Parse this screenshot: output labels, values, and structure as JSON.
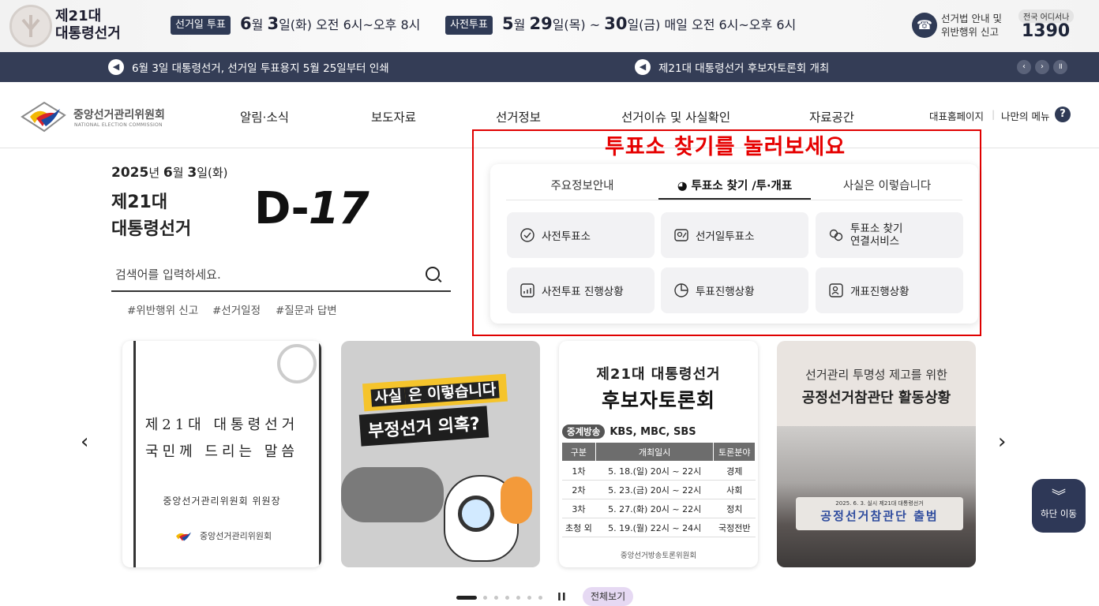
{
  "topbar": {
    "election_title_line1": "제21대",
    "election_title_line2": "대통령선거",
    "election_day_badge": "선거일 투표",
    "election_day_month": "6",
    "election_day_month_unit": "월",
    "election_day_date": "3",
    "election_day_rest": "일(화) 오전 6시~오후 8시",
    "early_vote_badge": "사전투표",
    "early_month": "5",
    "early_month_unit": "월",
    "early_date1": "29",
    "early_mid": "일(목) ~",
    "early_date2": "30",
    "early_rest": "일(금) 매일 오전 6시~오후 6시",
    "hotline_label_line1": "선거법 안내 및",
    "hotline_label_line2": "위반행위 신고",
    "hotline_small": "전국 어디서나",
    "hotline_number": "1390"
  },
  "newsbar": {
    "items": [
      "6월 3일 대통령선거, 선거일 투표용지 5월 25일부터 인쇄",
      "제21대 대통령선거 후보자토론회 개최"
    ]
  },
  "header": {
    "org_name": "중앙선거관리위원회",
    "org_name_en": "NATIONAL ELECTION COMMISSION",
    "menu": [
      "알림·소식",
      "보도자료",
      "선거정보",
      "선거이슈 및 사실확인",
      "자료공간"
    ],
    "util_home": "대표홈페이지",
    "util_mymenu": "나만의 메뉴",
    "help_glyph": "?"
  },
  "hero": {
    "date_year": "2025",
    "date_year_unit": "년",
    "date_month": "6",
    "date_month_unit": "월",
    "date_day": "3",
    "date_day_rest": "일(화)",
    "title_line1": "제21대",
    "title_line2": "대통령선거",
    "dday_prefix": "D-",
    "dday_num": "17",
    "search_placeholder": "검색어를 입력하세요.",
    "tags": [
      "#위반행위 신고",
      "#선거일정",
      "#질문과 답변"
    ]
  },
  "annotation": {
    "note": "투표소 찾기를 눌러보세요"
  },
  "panel": {
    "tabs": [
      "주요정보안내",
      "투표소 찾기 /투·개표",
      "사실은 이렇습니다"
    ],
    "buttons": [
      {
        "label": "사전투표소",
        "icon": "check-circle-icon"
      },
      {
        "label": "선거일투표소",
        "icon": "ballot-icon"
      },
      {
        "label": "투표소 찾기\n연결서비스",
        "icon": "link-icon"
      },
      {
        "label": "사전투표 진행상황",
        "icon": "chart-icon"
      },
      {
        "label": "투표진행상황",
        "icon": "pie-icon"
      },
      {
        "label": "개표진행상황",
        "icon": "person-check-icon"
      }
    ],
    "btn3_line1": "투표소 찾기",
    "btn3_line2": "연결서비스"
  },
  "carousel": {
    "prev_glyph": "‹",
    "next_glyph": "›",
    "card1": {
      "line1": "제21대 대통령선거",
      "line2": "국민께 드리는 말씀",
      "sign": "중앙선거관리위원회 위원장",
      "logo_text": "중앙선거관리위원회"
    },
    "card2": {
      "badge_highlight": "사실",
      "badge_rest": "은 이렇습니다",
      "title": "부정선거 의혹?"
    },
    "card3": {
      "title": "제21대 대통령선거",
      "subtitle": "후보자토론회",
      "broadcast_label": "중계방송",
      "broadcast": "KBS, MBC, SBS",
      "headers": [
        "구분",
        "개최일시",
        "토론분야"
      ],
      "rows": [
        [
          "1차",
          "5. 18.(일) 20시 ~ 22시",
          "경제"
        ],
        [
          "2차",
          "5. 23.(금) 20시 ~ 22시",
          "사회"
        ],
        [
          "3차",
          "5. 27.(화) 20시 ~ 22시",
          "정치"
        ],
        [
          "초청 외",
          "5. 19.(월) 22시 ~ 24시",
          "국정전반"
        ]
      ],
      "footer": "중앙선거방송토론위원회"
    },
    "card4": {
      "subtitle": "선거관리 투명성 제고를 위한",
      "title": "공정선거참관단 활동상황",
      "banner_small": "2025. 6. 3. 실시 제21대 대통령선거",
      "banner_big": "공정선거참관단 출범"
    },
    "pause_glyph": "II",
    "view_all": "전체보기",
    "dot_count": 7,
    "active_dot": 0
  },
  "float": {
    "label": "하단 이동",
    "glyph": "⌄"
  },
  "colors": {
    "navy": "#2f3a55",
    "newsbar": "#343d56",
    "annotation_red": "#e00000"
  }
}
